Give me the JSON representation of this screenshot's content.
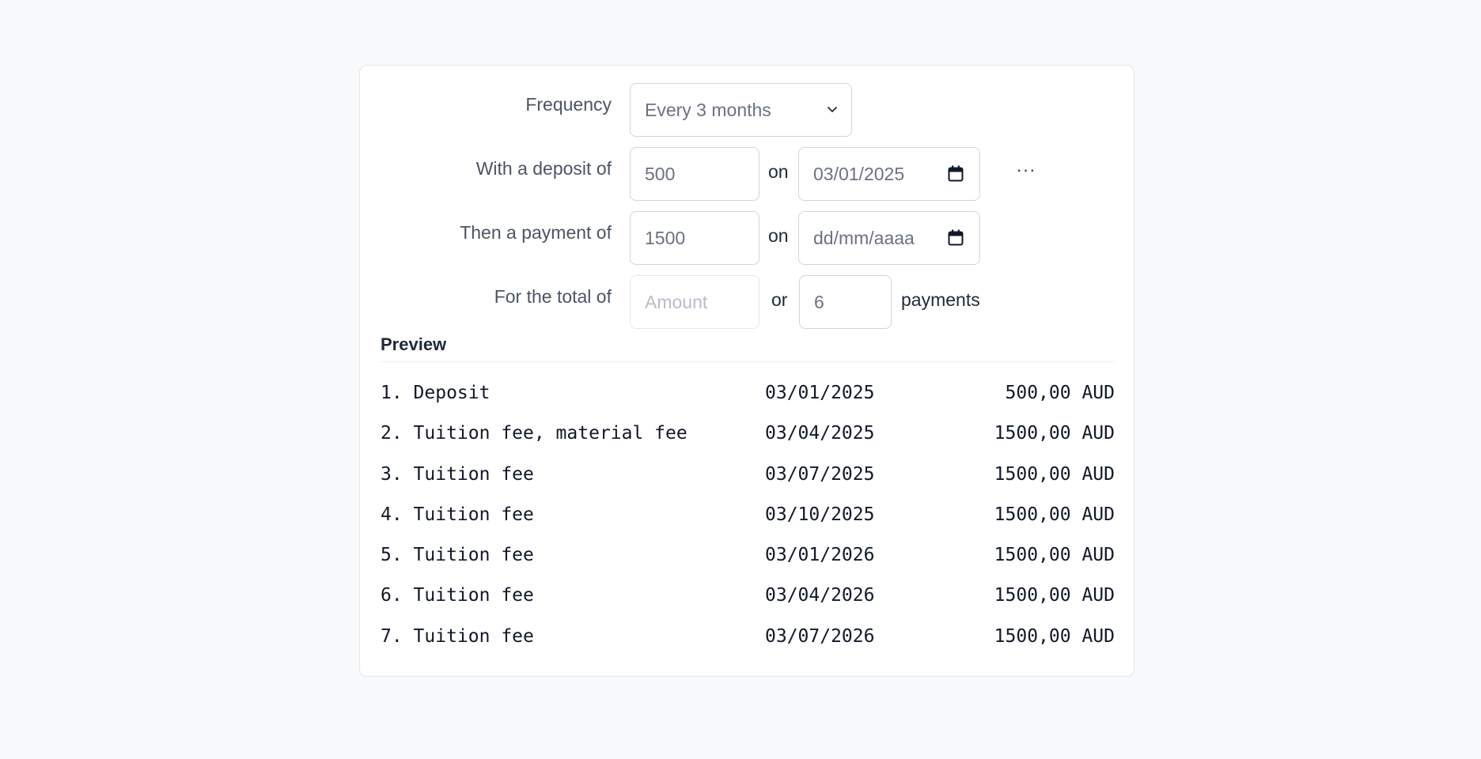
{
  "form": {
    "frequency": {
      "label": "Frequency",
      "selected": "Every 3 months",
      "icon": "chevron-down-icon"
    },
    "deposit": {
      "label": "With a deposit of",
      "amount": "500",
      "on_label": "on",
      "date": "03/01/2025",
      "more_label": "···"
    },
    "payment": {
      "label": "Then a payment of",
      "amount": "1500",
      "on_label": "on",
      "date_placeholder": "dd/mm/aaaa"
    },
    "total": {
      "label": "For the total of",
      "amount_placeholder": "Amount",
      "or_label": "or",
      "count": "6",
      "payments_label": "payments"
    }
  },
  "preview": {
    "title": "Preview",
    "rows": [
      {
        "description": "1. Deposit",
        "date": "03/01/2025",
        "amount": "500,00 AUD"
      },
      {
        "description": "2. Tuition fee, material fee",
        "date": "03/04/2025",
        "amount": "1500,00 AUD"
      },
      {
        "description": "3. Tuition fee",
        "date": "03/07/2025",
        "amount": "1500,00 AUD"
      },
      {
        "description": "4. Tuition fee",
        "date": "03/10/2025",
        "amount": "1500,00 AUD"
      },
      {
        "description": "5. Tuition fee",
        "date": "03/01/2026",
        "amount": "1500,00 AUD"
      },
      {
        "description": "6. Tuition fee",
        "date": "03/04/2026",
        "amount": "1500,00 AUD"
      },
      {
        "description": "7. Tuition fee",
        "date": "03/07/2026",
        "amount": "1500,00 AUD"
      }
    ]
  },
  "colors": {
    "page_background": "#f8f9fb",
    "card_background": "#ffffff",
    "label_text": "#4b5563",
    "input_border": "#d1d5db",
    "placeholder_text": "#b7bec8"
  }
}
